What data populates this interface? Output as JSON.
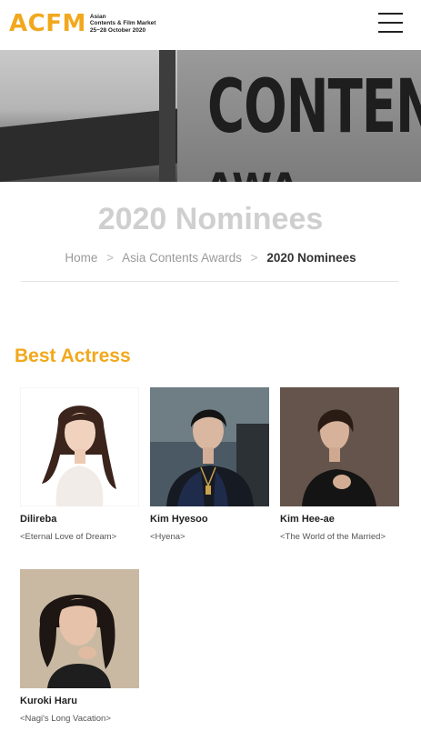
{
  "header": {
    "logo_mark": "ACFM",
    "logo_line1": "Asian",
    "logo_line2": "Contents & Film Market",
    "logo_line3": "25~28 October 2020"
  },
  "hero": {
    "sign_text": "CONTENT",
    "sign_text_2": "AWA"
  },
  "page": {
    "title": "2020 Nominees"
  },
  "breadcrumb": {
    "home": "Home",
    "section": "Asia Contents Awards",
    "current": "2020 Nominees",
    "separator": ">"
  },
  "category": {
    "title": "Best Actress"
  },
  "nominees": [
    {
      "name": "Dilireba",
      "work": "<Eternal Love of Dream>"
    },
    {
      "name": "Kim Hyesoo",
      "work": "<Hyena>"
    },
    {
      "name": "Kim Hee-ae",
      "work": "<The World of the Married>"
    },
    {
      "name": "Kuroki Haru",
      "work": "<Nagi's Long Vacation>"
    }
  ],
  "colors": {
    "accent": "#f2a81d",
    "title_gray": "#cfcfcf"
  }
}
